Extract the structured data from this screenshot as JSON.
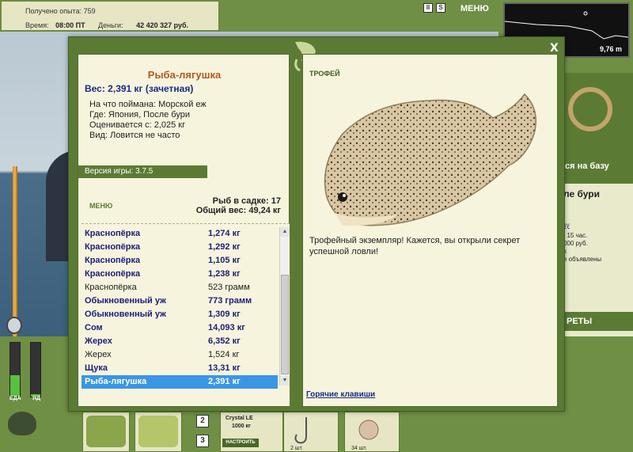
{
  "hud": {
    "exp_label": "Получено опыта:",
    "exp_value": "759",
    "time_label": "Время:",
    "time_value": "08:00 ПТ",
    "money_label": "Деньги:",
    "money_value": "42 420 327 руб.",
    "btn_pause": "II",
    "btn_s": "S",
    "menu_label": "МЕНЮ",
    "depth": "9,76 m"
  },
  "dialog": {
    "close_label": "X",
    "catch": {
      "name": "Рыба-лягушка",
      "weight": "Вес: 2,391 кг (зачетная)",
      "bait": "На что поймана: Морской еж",
      "place": "Где: Япония, После бури",
      "valued": "Оценивается с: 2,025 кг",
      "rarity": "Вид: Ловится не часто"
    },
    "version": "Версия игры: 3.7.5",
    "menu_link": "МЕНЮ",
    "keep_count": "Рыб в садке: 17",
    "keep_weight": "Общий вес: 49,24 кг",
    "catch_list": [
      {
        "name": "Краснопёрка",
        "weight": "1,274 кг",
        "style": "bold"
      },
      {
        "name": "Краснопёрка",
        "weight": "1,292 кг",
        "style": "bold"
      },
      {
        "name": "Краснопёрка",
        "weight": "1,105 кг",
        "style": "bold"
      },
      {
        "name": "Краснопёрка",
        "weight": "1,238 кг",
        "style": "bold"
      },
      {
        "name": "Краснопёрка",
        "weight": "523 грамм",
        "style": "plain"
      },
      {
        "name": "Обыкновенный уж",
        "weight": "773 грамм",
        "style": "bold"
      },
      {
        "name": "Обыкновенный уж",
        "weight": "1,309 кг",
        "style": "bold"
      },
      {
        "name": "Сом",
        "weight": "14,093 кг",
        "style": "bold"
      },
      {
        "name": "Жерех",
        "weight": "6,352 кг",
        "style": "bold"
      },
      {
        "name": "Жерех",
        "weight": "1,524 кг",
        "style": "plain"
      },
      {
        "name": "Щука",
        "weight": "13,31 кг",
        "style": "bold"
      },
      {
        "name": "Рыба-лягушка",
        "weight": "2,391 кг",
        "style": "sel"
      }
    ],
    "trophy_label": "ТРОФЕЙ",
    "trophy_text": "Трофейный экземпляр! Кажется, вы открыли секрет успешной ловли!",
    "hotkeys": "Горячие клавиши"
  },
  "right_panel": {
    "base_label": "ся на базу",
    "place_label": "ле бури",
    "line1": "ку",
    "line2": ": 15 час.",
    "line3": "000 руб.",
    "line4": "х",
    "line5": "е объявлены",
    "secrets_label": "РЕТЫ",
    "line6": "х"
  },
  "bottom": {
    "food_label": "ЕДА",
    "poison_label": "ЯД",
    "food_level": 0.4,
    "poison_level": 0.05,
    "slot2": "2",
    "slot3": "3",
    "bait_name": "Crystal LE",
    "bait_weight": "1000 кг",
    "setup_label": "НАСТРОИТЬ",
    "hook_qty": "2 шт.",
    "urchin_qty": "34 шт."
  }
}
